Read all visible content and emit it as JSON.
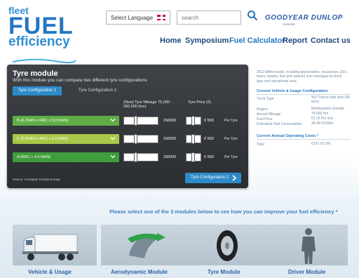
{
  "logo": {
    "line1": "fleet",
    "line2": "FUEL",
    "line3": "efficiency"
  },
  "header": {
    "language_select": "Select Language",
    "search_placeholder": "search",
    "brand": "GOODYEAR DUNLOP",
    "brand_sub": "EUROPE"
  },
  "nav": {
    "items": [
      {
        "label": "Home"
      },
      {
        "label": "Symposium"
      },
      {
        "label": "Fuel Calculator",
        "active": true
      },
      {
        "label": "Report"
      },
      {
        "label": "Contact us"
      }
    ]
  },
  "tyre_module": {
    "title": "Tyre module",
    "subtitle": "With this module you can compare two different tyre configurations",
    "tabs": [
      {
        "label": "Tyre Configuration 1",
        "active": true
      },
      {
        "label": "Tyre Configuration 2",
        "active": false
      }
    ],
    "col_mileage": "(New) Tyre Mileage 75,000 - 300,000 (km)",
    "col_price": "Tyre Price (€)",
    "rows": [
      {
        "tyre": "B (4.1%Kh x RRC x 5.0 N/kN)",
        "mileage": "150000",
        "price": "€ 500",
        "per": "Per Tyre",
        "color": "#5fae45",
        "mileage_fill": 0.33,
        "price_fill": 0.5
      },
      {
        "tyre": "C (5.5%Kh x RRC x 5.5 N/kN)",
        "mileage": "150000",
        "price": "€ 500",
        "per": "Per Tyre",
        "color": "#a9c84a",
        "mileage_fill": 0.33,
        "price_fill": 0.5
      },
      {
        "tyre": "A (RRC < 4.0 N/kN)",
        "mileage": "150000",
        "price": "€ 500",
        "per": "Per Tyre",
        "color": "#3f9e3b",
        "mileage_fill": 0.33,
        "price_fill": 0.5
      }
    ],
    "source": "Source: Goodyear Dunlop Europe",
    "next_button": "Tyre Configuration 2"
  },
  "sidebar": {
    "note": "2012 MAN model, including depreciation, insurances, EFu taxes, repairs, fuel and salaries over averages by truck type and operational area",
    "usage_header": "Current Vehicle & Usage Configuration",
    "usage": [
      {
        "key": "Truck Type",
        "value": "4x2 Tractor with tank (40 tons)"
      },
      {
        "key": "Region",
        "value": "Northwestern Europe"
      },
      {
        "key": "Annual Mileage",
        "value": "78.000 Km"
      },
      {
        "key": "Fuel Price",
        "value": "€1.25 Per litre"
      },
      {
        "key": "Estimated Fuel Consumption",
        "value": "34.49 l/100km"
      }
    ],
    "cost_header": "Current Annual Operating Costs *",
    "cost_key": "Total",
    "cost_value": "€137,511.66"
  },
  "prompt": "Please select one of the 3 modules below to see how you can improve your fuel efficiency *",
  "modules": [
    {
      "label": "Vehicle & Usage"
    },
    {
      "label": "Aerodynamic Module"
    },
    {
      "label": "Tyre Module"
    },
    {
      "label": "Driver Module"
    }
  ],
  "colors": {
    "accent": "#2e8bc9",
    "brand_blue": "#2477c1",
    "panel": "#34383c"
  }
}
